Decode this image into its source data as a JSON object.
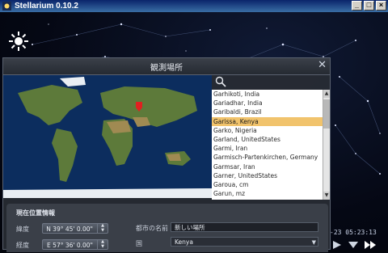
{
  "window": {
    "title": "Stellarium 0.10.2",
    "buttons": [
      "_",
      "□",
      "×"
    ]
  },
  "dialog": {
    "title": "観測場所",
    "close_label": "✕",
    "search": {
      "value": "",
      "placeholder": ""
    },
    "cities": [
      "Garhikoti, India",
      "Gariadhar, India",
      "Garibaldi, Brazil",
      "Garissa, Kenya",
      "Garko, Nigeria",
      "Garland, UnitedStates",
      "Garmi, Iran",
      "Garmisch-Partenkirchen, Germany",
      "Garmsar, Iran",
      "Garner, UnitedStates",
      "Garoua, cm",
      "Garun, mz"
    ],
    "selected_city": "Garissa, Kenya",
    "current_location": {
      "section_title": "現在位置情報",
      "latitude_label": "緯度",
      "latitude_value": "N 39°  45' 0.00\"",
      "longitude_label": "経度",
      "longitude_value": "E 57°  36' 0.00\"",
      "city_name_label": "都市の名前",
      "city_name_value": "新しい場所",
      "country_label": "国",
      "country_value": "Kenya"
    }
  },
  "clock": {
    "text": "-23   05:23:13"
  },
  "colors": {
    "selected_row": "#f1c36c",
    "marker": "#e02020"
  }
}
